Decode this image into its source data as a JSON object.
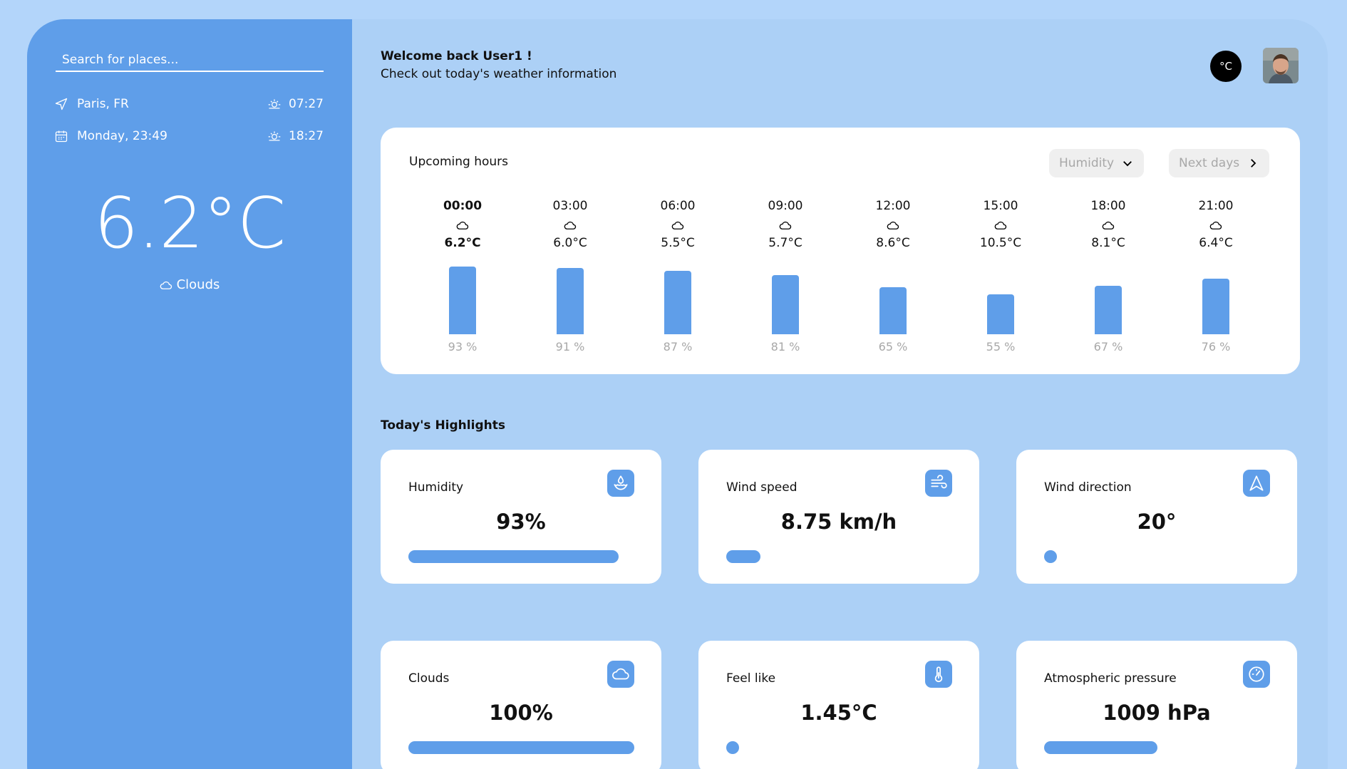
{
  "sidebar": {
    "search_placeholder": "Search for places...",
    "location": "Paris, FR",
    "sunrise": "07:27",
    "datetime": "Monday, 23:49",
    "sunset": "18:27",
    "temperature": "6.2°C",
    "condition": "Clouds"
  },
  "header": {
    "welcome": "Welcome back User1 !",
    "subtitle": "Check out today's weather information",
    "unit_button": "°C"
  },
  "hours": {
    "title": "Upcoming hours",
    "metric_select": "Humidity",
    "next_days": "Next days",
    "chart_data": {
      "type": "bar",
      "categories": [
        "00:00",
        "03:00",
        "06:00",
        "09:00",
        "12:00",
        "15:00",
        "18:00",
        "21:00"
      ],
      "temperatures": [
        "6.2°C",
        "6.0°C",
        "5.5°C",
        "5.7°C",
        "8.6°C",
        "10.5°C",
        "8.1°C",
        "6.4°C"
      ],
      "values": [
        93,
        91,
        87,
        81,
        65,
        55,
        67,
        76
      ],
      "value_labels": [
        "93 %",
        "91 %",
        "87 %",
        "81 %",
        "65 %",
        "55 %",
        "67 %",
        "76 %"
      ],
      "icon": "cloud-icon"
    }
  },
  "highlights": {
    "title": "Today's Highlights",
    "cards": [
      {
        "label": "Humidity",
        "value": "93%",
        "level": 0.93,
        "icon": "humidity-icon"
      },
      {
        "label": "Wind speed",
        "value": "8.75 km/h",
        "level": 0.15,
        "icon": "wind-icon"
      },
      {
        "label": "Wind direction",
        "value": "20°",
        "level": 0.0,
        "icon": "navigation-icon"
      },
      {
        "label": "Clouds",
        "value": "100%",
        "level": 1.0,
        "icon": "cloud-icon"
      },
      {
        "label": "Feel like",
        "value": "1.45°C",
        "level": 0.03,
        "icon": "thermometer-icon"
      },
      {
        "label": "Atmospheric pressure",
        "value": "1009 hPa",
        "level": 0.5,
        "icon": "gauge-icon"
      }
    ]
  },
  "colors": {
    "accent": "#5f9ee9",
    "background": "#b3d5fa",
    "panel": "#acd0f6"
  }
}
